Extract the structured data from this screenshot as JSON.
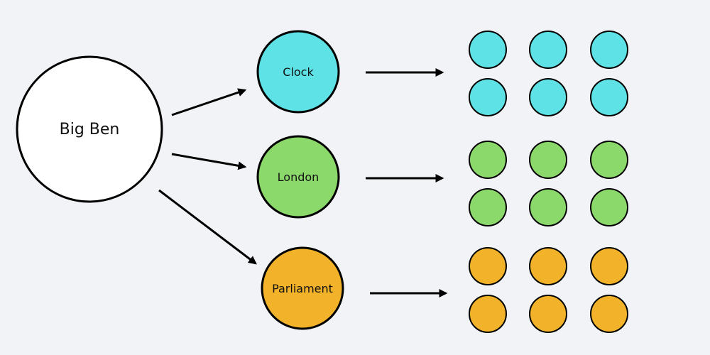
{
  "diagram": {
    "type": "concept-map",
    "root": {
      "id": "big-ben",
      "label": "Big Ben",
      "color": "#ffffff"
    },
    "nodes": [
      {
        "id": "clock",
        "label": "Clock",
        "color": "#5ee2e6",
        "children": 6
      },
      {
        "id": "london",
        "label": "London",
        "color": "#8cd96b",
        "children": 6
      },
      {
        "id": "parliament",
        "label": "Parliament",
        "color": "#f2b229",
        "children": 6
      }
    ],
    "edges": [
      {
        "from": "big-ben",
        "to": "clock"
      },
      {
        "from": "big-ben",
        "to": "london"
      },
      {
        "from": "big-ben",
        "to": "parliament"
      },
      {
        "from": "clock",
        "to": "clock-group"
      },
      {
        "from": "london",
        "to": "london-group"
      },
      {
        "from": "parliament",
        "to": "parliament-group"
      }
    ],
    "stroke_color": "#000000",
    "background": "#f2f3f7"
  }
}
